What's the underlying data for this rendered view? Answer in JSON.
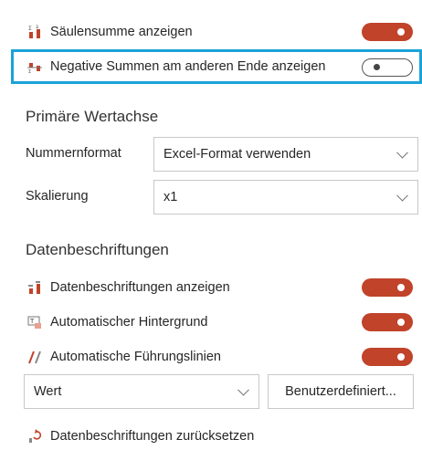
{
  "accent": "#c0432a",
  "highlight": "#1aa3d9",
  "options": {
    "column_sum": {
      "label": "Säulensumme anzeigen",
      "icon": "column-sum-icon",
      "checked": true
    },
    "negative_sums": {
      "label": "Negative Summen am anderen Ende anzeigen",
      "icon": "negative-sum-icon",
      "checked": false
    }
  },
  "primary_axis": {
    "heading": "Primäre Wertachse",
    "number_format": {
      "label": "Nummernformat",
      "value": "Excel-Format verwenden"
    },
    "scaling": {
      "label": "Skalierung",
      "value": "x1"
    }
  },
  "data_labels": {
    "heading": "Datenbeschriftungen",
    "show": {
      "label": "Datenbeschriftungen anzeigen",
      "icon": "data-labels-icon",
      "checked": true
    },
    "auto_background": {
      "label": "Automatischer Hintergrund",
      "icon": "auto-background-icon",
      "checked": true
    },
    "auto_leader_lines": {
      "label": "Automatische Führungslinien",
      "icon": "leader-lines-icon",
      "checked": true
    },
    "value_select": "Wert",
    "custom_button": "Benutzerdefiniert...",
    "reset": {
      "label": "Datenbeschriftungen zurücksetzen",
      "icon": "reset-labels-icon"
    }
  }
}
